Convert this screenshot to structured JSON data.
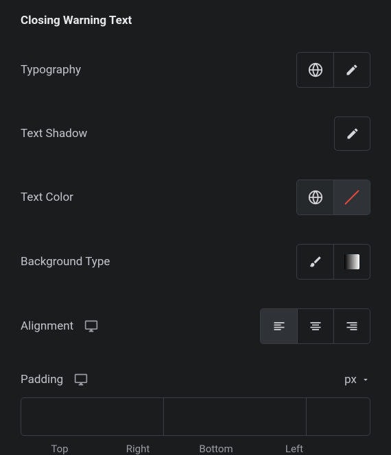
{
  "section": {
    "title": "Closing Warning Text"
  },
  "controls": {
    "typography": {
      "label": "Typography"
    },
    "textShadow": {
      "label": "Text Shadow"
    },
    "textColor": {
      "label": "Text Color"
    },
    "backgroundType": {
      "label": "Background Type"
    },
    "alignment": {
      "label": "Alignment",
      "selected": "left"
    },
    "padding": {
      "label": "Padding",
      "unit": "px",
      "top": "",
      "right": "",
      "bottom": "",
      "left": "",
      "sideLabels": {
        "top": "Top",
        "right": "Right",
        "bottom": "Bottom",
        "left": "Left"
      },
      "linked": true
    }
  },
  "icons": {
    "globe": "globe-icon",
    "edit": "pencil-icon",
    "noColor": "no-color-icon",
    "brush": "brush-icon",
    "gradient": "gradient-icon",
    "alignLeft": "align-left-icon",
    "alignCenter": "align-center-icon",
    "alignRight": "align-right-icon",
    "desktop": "desktop-icon",
    "link": "link-icon",
    "chevronDown": "chevron-down-icon"
  }
}
